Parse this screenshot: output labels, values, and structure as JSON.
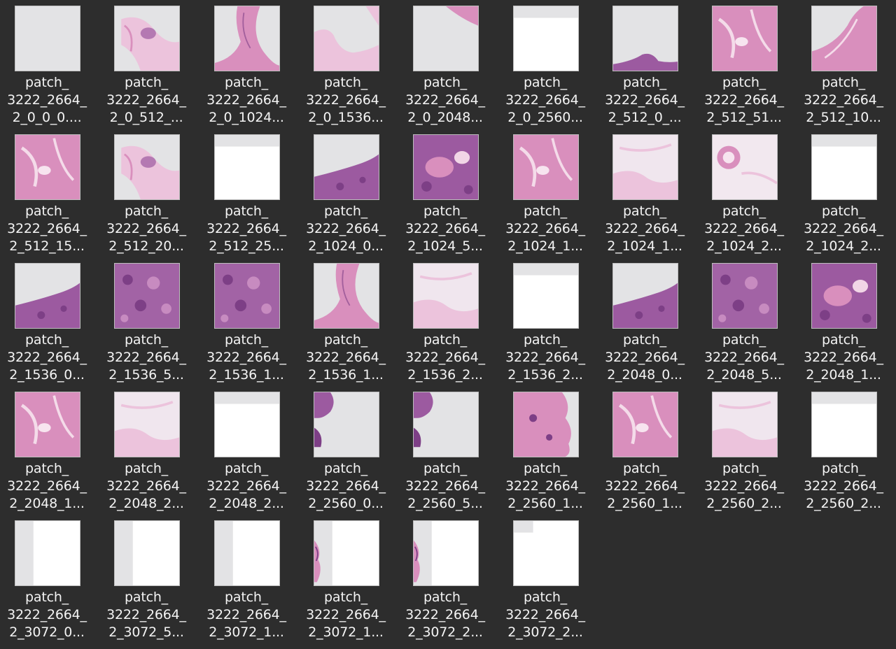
{
  "files": [
    {
      "lines": [
        "patch_",
        "3222_2664_",
        "2_0_0_0...."
      ],
      "thumb": "blank-gray"
    },
    {
      "lines": [
        "patch_",
        "3222_2664_",
        "2_0_512_..."
      ],
      "thumb": "tissue-sparse"
    },
    {
      "lines": [
        "patch_",
        "3222_2664_",
        "2_0_1024..."
      ],
      "thumb": "tissue-diagonal"
    },
    {
      "lines": [
        "patch_",
        "3222_2664_",
        "2_0_1536..."
      ],
      "thumb": "tissue-edge-light"
    },
    {
      "lines": [
        "patch_",
        "3222_2664_",
        "2_0_2048..."
      ],
      "thumb": "corner-tissue"
    },
    {
      "lines": [
        "patch_",
        "3222_2664_",
        "2_0_2560..."
      ],
      "thumb": "white-bar"
    },
    {
      "lines": [
        "patch_",
        "3222_2664_",
        "2_512_0_..."
      ],
      "thumb": "bottom-edge"
    },
    {
      "lines": [
        "patch_",
        "3222_2664_",
        "2_512_51..."
      ],
      "thumb": "tissue-pink"
    },
    {
      "lines": [
        "patch_",
        "3222_2664_",
        "2_512_10..."
      ],
      "thumb": "tissue-arc"
    },
    {
      "lines": [
        "patch_",
        "3222_2664_",
        "2_512_15..."
      ],
      "thumb": "tissue-pink"
    },
    {
      "lines": [
        "patch_",
        "3222_2664_",
        "2_512_20..."
      ],
      "thumb": "tissue-sparse"
    },
    {
      "lines": [
        "patch_",
        "3222_2664_",
        "2_512_25..."
      ],
      "thumb": "white-bar"
    },
    {
      "lines": [
        "patch_",
        "3222_2664_",
        "2_1024_0..."
      ],
      "thumb": "tissue-bottom-purple"
    },
    {
      "lines": [
        "patch_",
        "3222_2664_",
        "2_1024_5..."
      ],
      "thumb": "tissue-purple"
    },
    {
      "lines": [
        "patch_",
        "3222_2664_",
        "2_1024_1..."
      ],
      "thumb": "tissue-pink"
    },
    {
      "lines": [
        "patch_",
        "3222_2664_",
        "2_1024_1..."
      ],
      "thumb": "tissue-light"
    },
    {
      "lines": [
        "patch_",
        "3222_2664_",
        "2_1024_2..."
      ],
      "thumb": "tissue-ring"
    },
    {
      "lines": [
        "patch_",
        "3222_2664_",
        "2_1024_2..."
      ],
      "thumb": "white-bar"
    },
    {
      "lines": [
        "patch_",
        "3222_2664_",
        "2_1536_0..."
      ],
      "thumb": "tissue-bottom-purple"
    },
    {
      "lines": [
        "patch_",
        "3222_2664_",
        "2_1536_5..."
      ],
      "thumb": "tissue-purple-dense"
    },
    {
      "lines": [
        "patch_",
        "3222_2664_",
        "2_1536_1..."
      ],
      "thumb": "tissue-purple-dense"
    },
    {
      "lines": [
        "patch_",
        "3222_2664_",
        "2_1536_1..."
      ],
      "thumb": "tissue-diagonal"
    },
    {
      "lines": [
        "patch_",
        "3222_2664_",
        "2_1536_2..."
      ],
      "thumb": "tissue-light"
    },
    {
      "lines": [
        "patch_",
        "3222_2664_",
        "2_1536_2..."
      ],
      "thumb": "white-bar"
    },
    {
      "lines": [
        "patch_",
        "3222_2664_",
        "2_2048_0..."
      ],
      "thumb": "tissue-bottom-purple"
    },
    {
      "lines": [
        "patch_",
        "3222_2664_",
        "2_2048_5..."
      ],
      "thumb": "tissue-purple-dense"
    },
    {
      "lines": [
        "patch_",
        "3222_2664_",
        "2_2048_1..."
      ],
      "thumb": "tissue-purple"
    },
    {
      "lines": [
        "patch_",
        "3222_2664_",
        "2_2048_1..."
      ],
      "thumb": "tissue-pink"
    },
    {
      "lines": [
        "patch_",
        "3222_2664_",
        "2_2048_2..."
      ],
      "thumb": "tissue-light"
    },
    {
      "lines": [
        "patch_",
        "3222_2664_",
        "2_2048_2..."
      ],
      "thumb": "white-bar"
    },
    {
      "lines": [
        "patch_",
        "3222_2664_",
        "2_2560_0..."
      ],
      "thumb": "left-tissue"
    },
    {
      "lines": [
        "patch_",
        "3222_2664_",
        "2_2560_5..."
      ],
      "thumb": "left-tissue"
    },
    {
      "lines": [
        "patch_",
        "3222_2664_",
        "2_2560_1..."
      ],
      "thumb": "tissue-right-edge"
    },
    {
      "lines": [
        "patch_",
        "3222_2664_",
        "2_2560_1..."
      ],
      "thumb": "tissue-pink"
    },
    {
      "lines": [
        "patch_",
        "3222_2664_",
        "2_2560_2..."
      ],
      "thumb": "tissue-light"
    },
    {
      "lines": [
        "patch_",
        "3222_2664_",
        "2_2560_2..."
      ],
      "thumb": "white-bar"
    },
    {
      "lines": [
        "patch_",
        "3222_2664_",
        "2_3072_0..."
      ],
      "thumb": "left-strip"
    },
    {
      "lines": [
        "patch_",
        "3222_2664_",
        "2_3072_5..."
      ],
      "thumb": "left-strip"
    },
    {
      "lines": [
        "patch_",
        "3222_2664_",
        "2_3072_1..."
      ],
      "thumb": "left-strip"
    },
    {
      "lines": [
        "patch_",
        "3222_2664_",
        "2_3072_1..."
      ],
      "thumb": "left-strip-tissue"
    },
    {
      "lines": [
        "patch_",
        "3222_2664_",
        "2_3072_2..."
      ],
      "thumb": "left-strip-tissue"
    },
    {
      "lines": [
        "patch_",
        "3222_2664_",
        "2_3072_2..."
      ],
      "thumb": "corner-block"
    }
  ]
}
